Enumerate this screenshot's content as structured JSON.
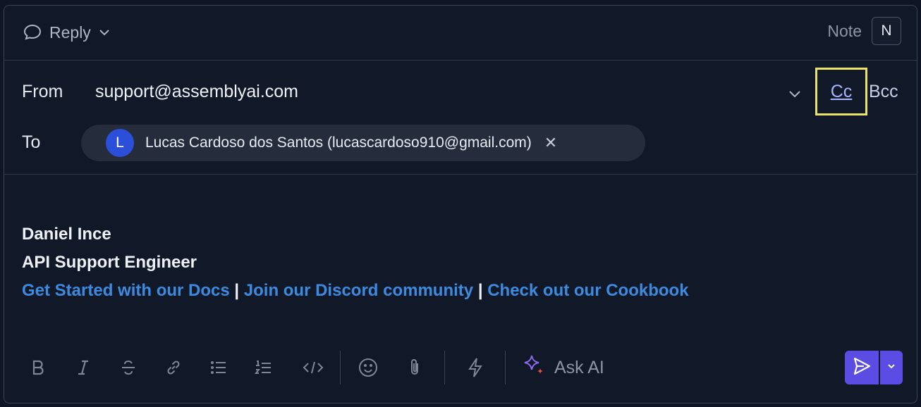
{
  "header": {
    "reply_label": "Reply",
    "note_label": "Note",
    "note_shortcut": "N"
  },
  "recipients": {
    "from_label": "From",
    "from_value": "support@assemblyai.com",
    "cc_label": "Cc",
    "bcc_label": "Bcc",
    "to_label": "To",
    "to_chip": {
      "avatar_initial": "L",
      "text": "Lucas Cardoso dos Santos (lucascardoso910@gmail.com)"
    }
  },
  "signature": {
    "name": "Daniel Ince",
    "title": "API Support Engineer",
    "links": [
      "Get Started with our Docs",
      "Join our Discord community",
      "Check out our Cookbook"
    ],
    "separator": "|"
  },
  "toolbar": {
    "ask_ai_label": "Ask AI",
    "icons": [
      "bold-icon",
      "italic-icon",
      "strikethrough-icon",
      "link-icon",
      "bullet-list-icon",
      "numbered-list-icon",
      "code-icon",
      "emoji-icon",
      "attachment-icon",
      "lightning-icon",
      "sparkle-icon",
      "send-icon",
      "chevron-down-icon"
    ]
  },
  "colors": {
    "background": "#111827",
    "accent": "#5b4de3",
    "link": "#3d8be0",
    "highlight_box": "#eae56a",
    "cc_text": "#aab4ff"
  }
}
